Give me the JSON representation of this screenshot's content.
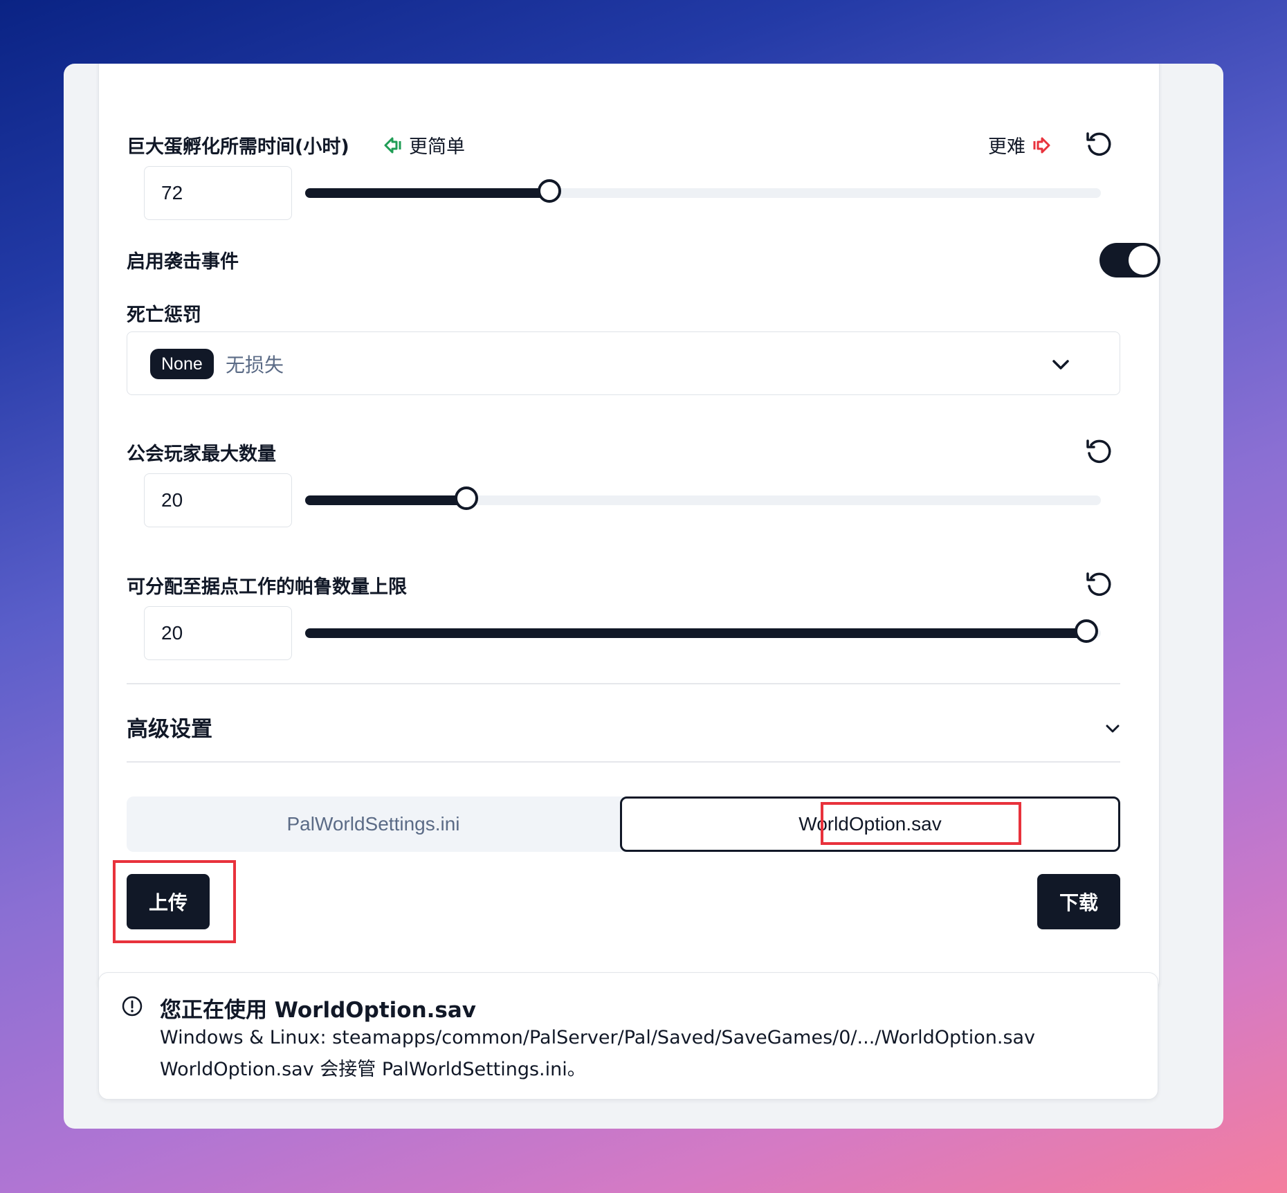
{
  "settings": {
    "egg_hatch": {
      "label": "巨大蛋孵化所需时间(小时)",
      "easier_label": "更简单",
      "harder_label": "更难",
      "value": "72",
      "slider_fraction": 0.307
    },
    "raid_event": {
      "label": "启用袭击事件",
      "enabled": true
    },
    "death_penalty": {
      "label": "死亡惩罚",
      "selected_badge": "None",
      "selected_text": "无损失"
    },
    "guild_max_players": {
      "label": "公会玩家最大数量",
      "value": "20",
      "slider_fraction": 0.203
    },
    "base_camp_workers": {
      "label": "可分配至据点工作的帕鲁数量上限",
      "value": "20",
      "slider_fraction": 0.982
    }
  },
  "advanced": {
    "label": "高级设置"
  },
  "file_tabs": [
    {
      "label": "PalWorldSettings.ini",
      "active": false
    },
    {
      "label": "WorldOption.sav",
      "active": true
    }
  ],
  "actions": {
    "upload_label": "上传",
    "download_label": "下载"
  },
  "notice": {
    "title": "您正在使用 WorldOption.sav",
    "line1": "Windows & Linux: steamapps/common/PalServer/Pal/Saved/SaveGames/0/.../WorldOption.sav",
    "line2": "WorldOption.sav 会接管 PalWorldSettings.ini。"
  },
  "colors": {
    "primary": "#111827",
    "easier_icon": "#1f9d55",
    "harder_icon": "#e8323c",
    "highlight": "#e8323c"
  }
}
